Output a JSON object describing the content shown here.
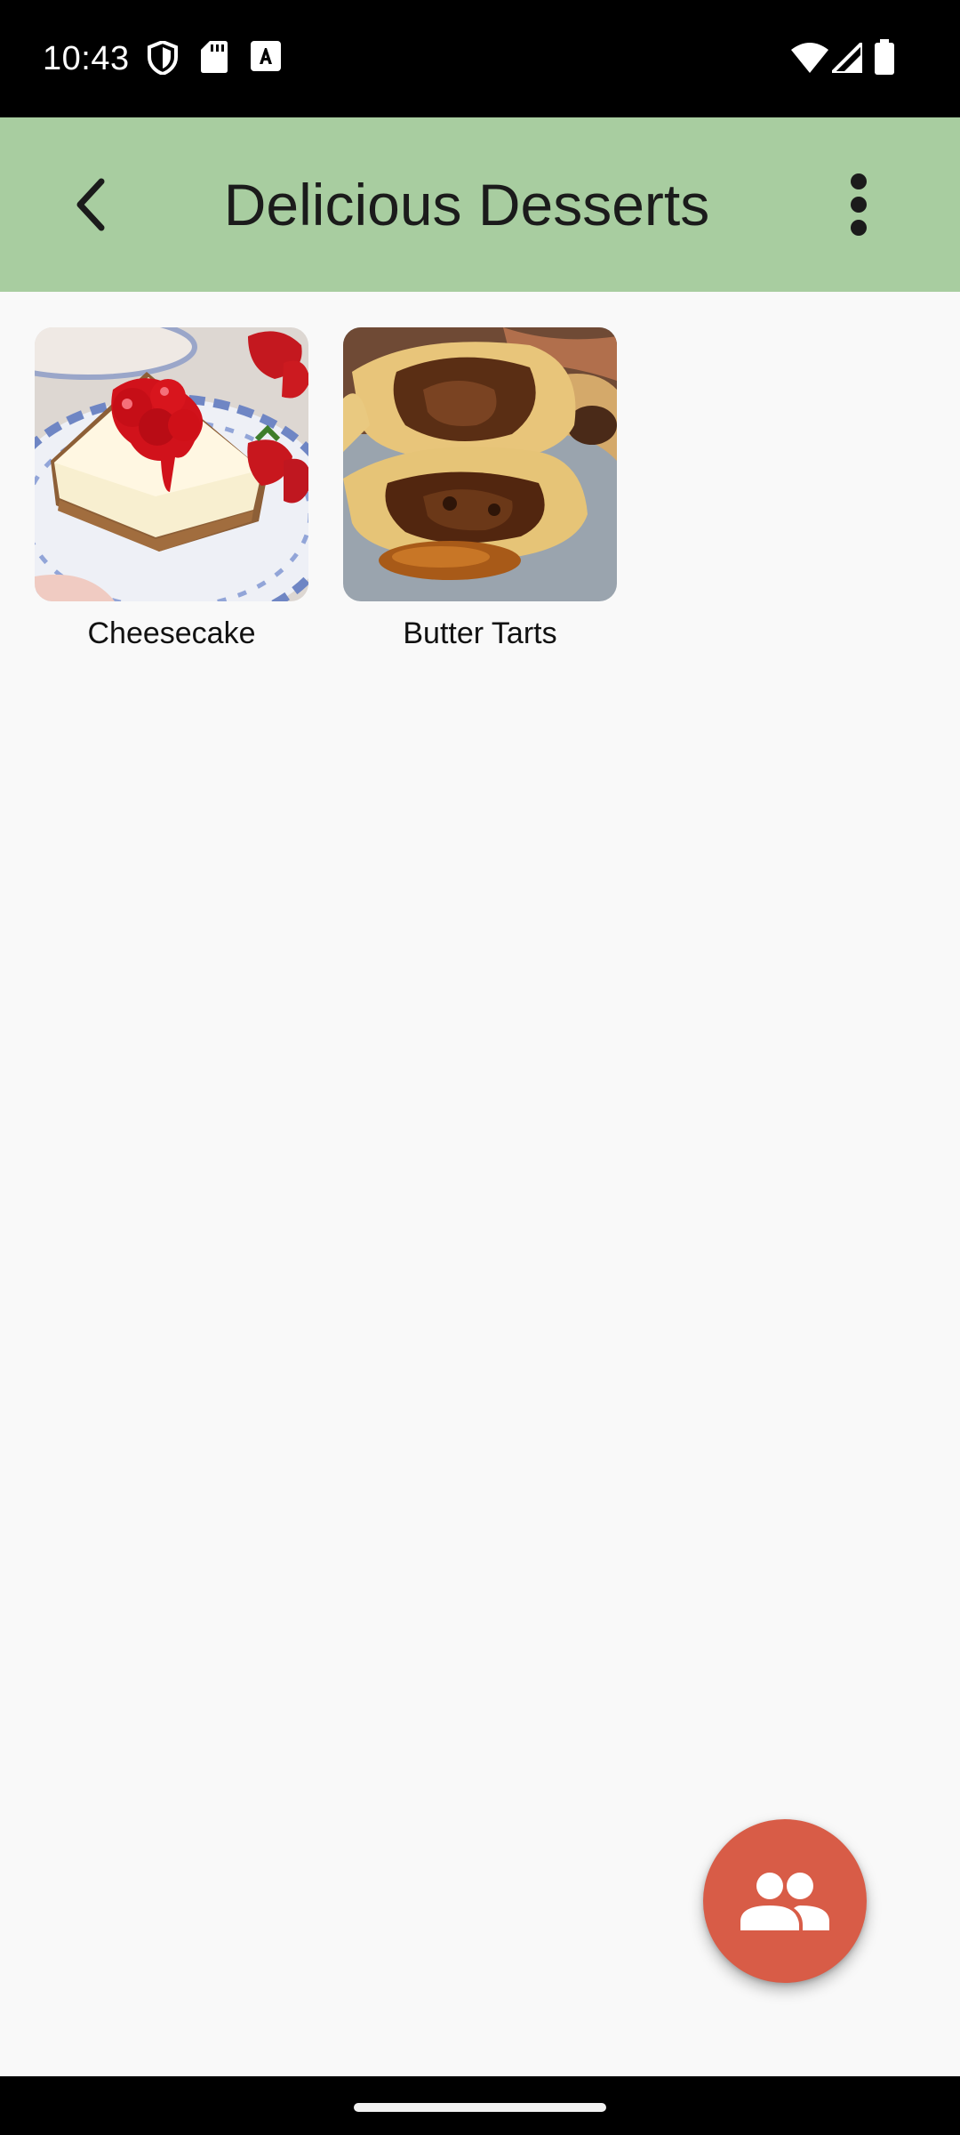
{
  "status_bar": {
    "time": "10:43",
    "left_icons": [
      "shield-icon",
      "sd-card-icon",
      "font-download-icon"
    ],
    "right_icons": [
      "wifi-icon",
      "signal-icon",
      "battery-icon"
    ]
  },
  "app_bar": {
    "title": "Delicious Desserts",
    "background": "#a8cda0",
    "back_icon": "chevron-left-icon",
    "menu_icon": "more-vert-icon"
  },
  "items": [
    {
      "label": "Cheesecake",
      "image": "cheesecake-photo"
    },
    {
      "label": "Butter Tarts",
      "image": "butter-tarts-photo"
    }
  ],
  "fab": {
    "icon": "group-icon",
    "color": "#d85c47"
  },
  "colors": {
    "background": "#f9f9f9",
    "system_bars": "#000000"
  }
}
